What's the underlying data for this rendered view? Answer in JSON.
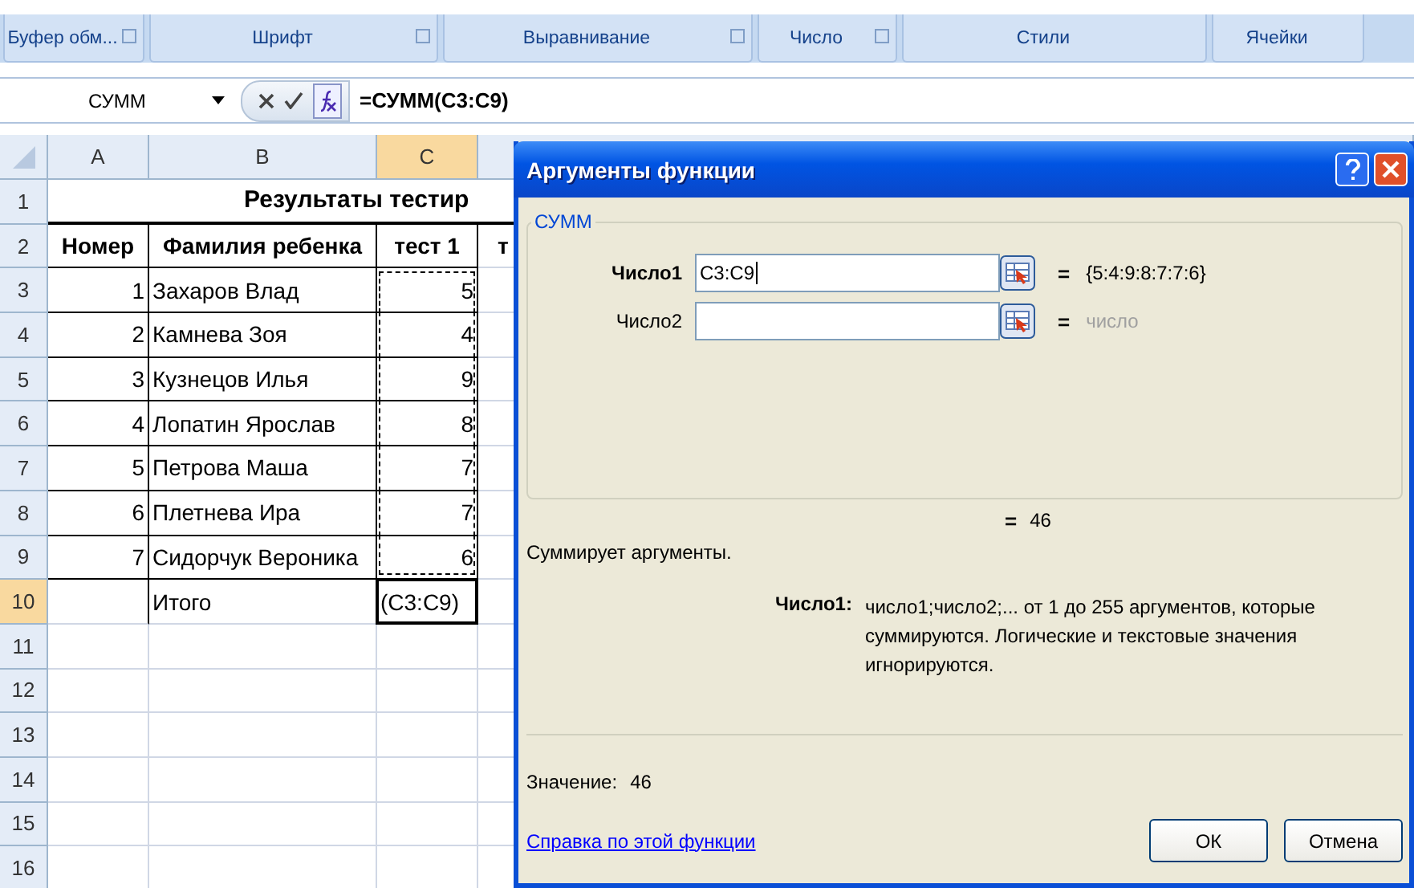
{
  "ribbon_groups": [
    {
      "label": "Буфер обм...",
      "launcher": true
    },
    {
      "label": "Шрифт",
      "launcher": true
    },
    {
      "label": "Выравнивание",
      "launcher": true
    },
    {
      "label": "Число",
      "launcher": true
    },
    {
      "label": "Стили",
      "launcher": false
    },
    {
      "label": "Ячейки",
      "launcher": false
    }
  ],
  "formula_bar": {
    "name_box": "СУММ",
    "formula": "=СУММ(C3:C9)"
  },
  "sheet": {
    "columns": [
      {
        "label": "A",
        "selected": false
      },
      {
        "label": "B",
        "selected": false
      },
      {
        "label": "C",
        "selected": true
      }
    ],
    "rows": [
      {
        "number": "1",
        "selected": false,
        "title": "Результаты тестир"
      },
      {
        "number": "2",
        "selected": false,
        "kind": "header",
        "cells": [
          "Номер",
          "Фамилия ребенка",
          "тест 1",
          "т"
        ]
      },
      {
        "number": "3",
        "selected": false,
        "kind": "data",
        "cells": [
          "1",
          "Захаров Влад",
          "5"
        ]
      },
      {
        "number": "4",
        "selected": false,
        "kind": "data",
        "cells": [
          "2",
          "Камнева Зоя",
          "4"
        ]
      },
      {
        "number": "5",
        "selected": false,
        "kind": "data",
        "cells": [
          "3",
          "Кузнецов Илья",
          "9"
        ]
      },
      {
        "number": "6",
        "selected": false,
        "kind": "data",
        "cells": [
          "4",
          "Лопатин Ярослав",
          "8"
        ]
      },
      {
        "number": "7",
        "selected": false,
        "kind": "data",
        "cells": [
          "5",
          "Петрова Маша",
          "7"
        ]
      },
      {
        "number": "8",
        "selected": false,
        "kind": "data",
        "cells": [
          "6",
          "Плетнева Ира",
          "7"
        ]
      },
      {
        "number": "9",
        "selected": false,
        "kind": "data",
        "cells": [
          "7",
          "Сидорчук Вероника",
          "6"
        ]
      },
      {
        "number": "10",
        "selected": true,
        "kind": "total",
        "cells": [
          "",
          "Итого",
          "(C3:C9)"
        ]
      },
      {
        "number": "11",
        "selected": false
      },
      {
        "number": "12",
        "selected": false
      },
      {
        "number": "13",
        "selected": false
      },
      {
        "number": "14",
        "selected": false
      },
      {
        "number": "15",
        "selected": false
      },
      {
        "number": "16",
        "selected": false
      }
    ]
  },
  "dialog": {
    "title": "Аргументы функции",
    "function_name": "СУММ",
    "arguments": [
      {
        "label": "Число1",
        "value": "C3:C9",
        "equals": "=",
        "result": "{5:4:9:8:7:7:6}",
        "active": true
      },
      {
        "label": "Число2",
        "equals": "=",
        "result": "число",
        "active": false
      }
    ],
    "result_equals": "=",
    "result": "46",
    "description": "Суммирует аргументы.",
    "arg_help_label": "Число1:",
    "arg_help": "число1;число2;... от 1 до 255 аргументов, которые суммируются. Логические и текстовые значения игнорируются.",
    "value_label": "Значение:",
    "value": "46",
    "help_link": "Справка по этой функции",
    "buttons": [
      "ОК",
      "Отмена"
    ]
  }
}
